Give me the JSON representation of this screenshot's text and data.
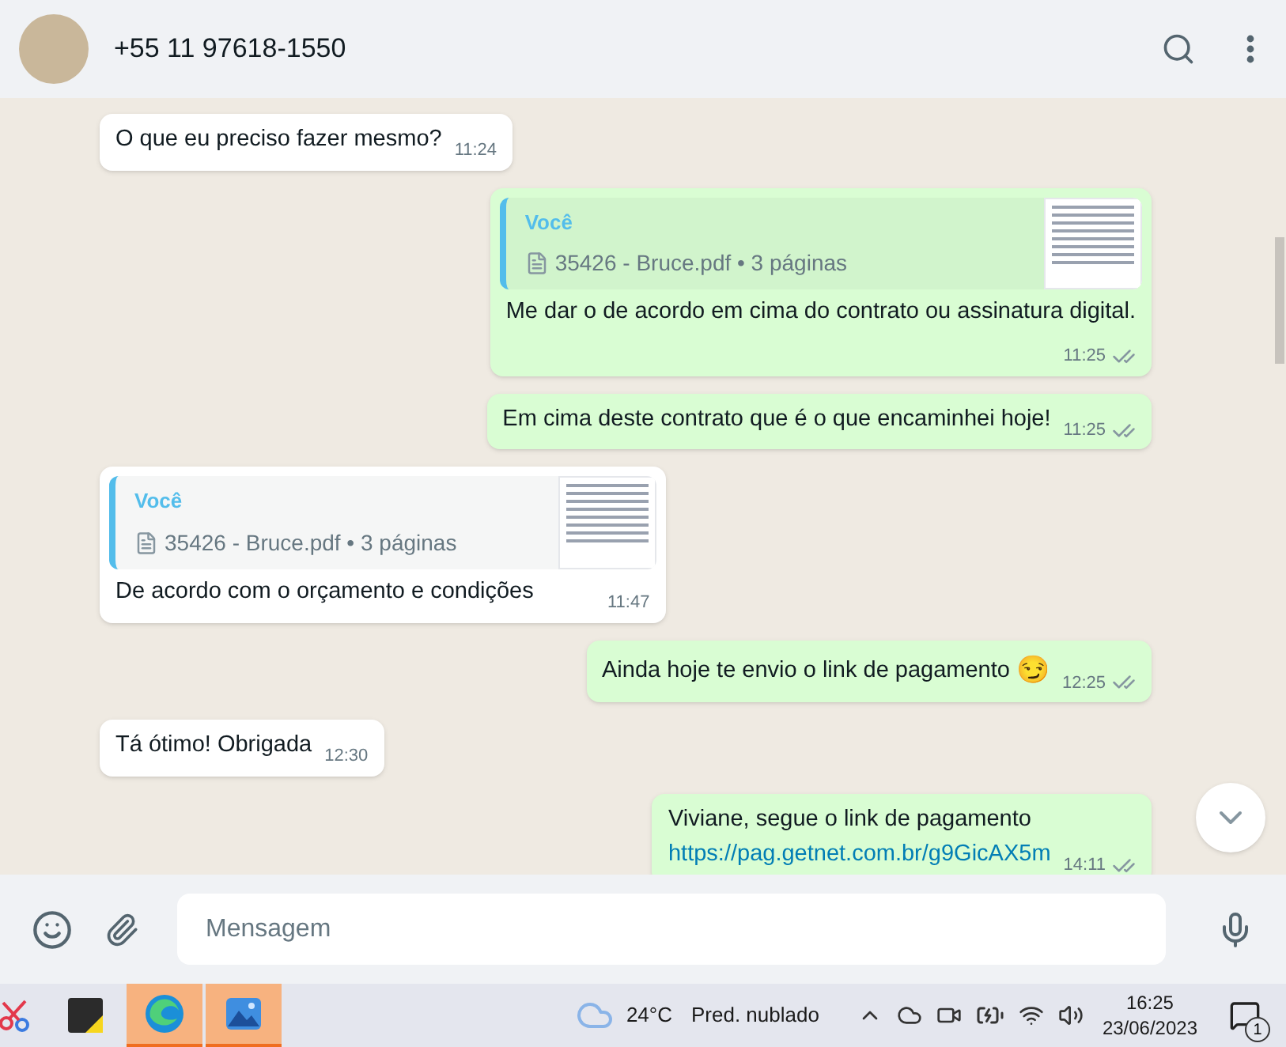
{
  "header": {
    "contact": "+55 11 97618-1550"
  },
  "messages": [
    {
      "kind": "text",
      "outgoing": false,
      "text": "O que eu preciso fazer mesmo?",
      "time": "11:24"
    },
    {
      "kind": "document",
      "outgoing": true,
      "sender": "Você",
      "file": "35426 - Bruce.pdf • 3 páginas",
      "text": "Me dar o de acordo em cima do contrato ou assinatura digital.",
      "time": "11:25",
      "read": false
    },
    {
      "kind": "text",
      "outgoing": true,
      "text": "Em cima deste contrato que é o que encaminhei hoje!",
      "time": "11:25",
      "read": false
    },
    {
      "kind": "document",
      "outgoing": false,
      "sender": "Você",
      "file": "35426 - Bruce.pdf • 3 páginas",
      "text": "De acordo com o orçamento e condições",
      "time": "11:47"
    },
    {
      "kind": "text",
      "outgoing": true,
      "text": "Ainda hoje te envio o link de pagamento",
      "emoji": "😏",
      "time": "12:25",
      "read": false
    },
    {
      "kind": "text",
      "outgoing": false,
      "text": "Tá ótimo! Obrigada",
      "time": "12:30"
    },
    {
      "kind": "link",
      "outgoing": true,
      "text": "Viviane, segue o link de pagamento",
      "link": "https://pag.getnet.com.br/g9GicAX5m",
      "time": "14:11",
      "read": false
    }
  ],
  "composer": {
    "placeholder": "Mensagem"
  },
  "taskbar": {
    "apps": [
      {
        "kind": "snip",
        "active": false
      },
      {
        "kind": "notes",
        "active": false
      },
      {
        "kind": "edge",
        "active": true
      },
      {
        "kind": "photos",
        "active": true
      }
    ],
    "weather": {
      "temp": "24°C",
      "desc": "Pred. nublado"
    },
    "time": "16:25",
    "date": "23/06/2023",
    "notifications": "1"
  }
}
